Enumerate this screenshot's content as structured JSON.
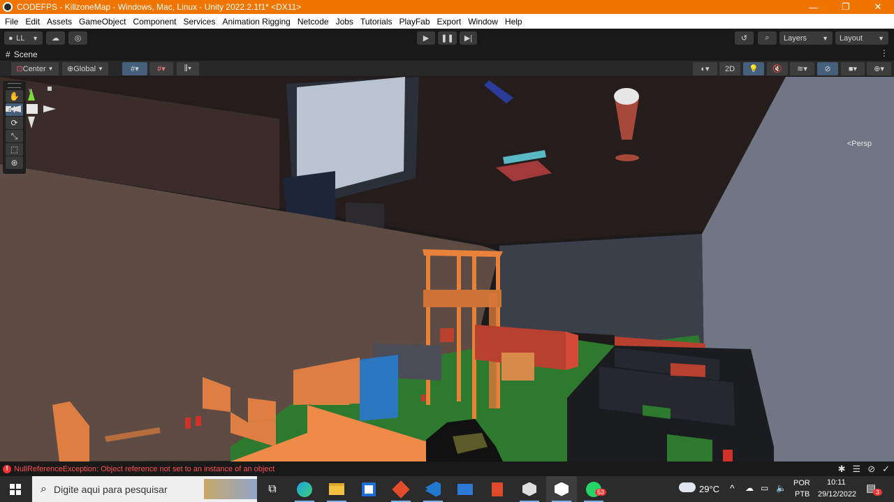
{
  "window": {
    "title": "CODEFPS - KillzoneMap - Windows, Mac, Linux - Unity 2022.2.1f1* <DX11>",
    "minimize": "—",
    "restore": "❐",
    "close": "✕"
  },
  "menu": [
    "File",
    "Edit",
    "Assets",
    "GameObject",
    "Component",
    "Services",
    "Animation Rigging",
    "Netcode",
    "Jobs",
    "Tutorials",
    "PlayFab",
    "Export",
    "Window",
    "Help"
  ],
  "toolbar": {
    "account": "LL",
    "layers": "Layers",
    "layout": "Layout"
  },
  "scene": {
    "tab_label": "Scene",
    "pivot": "Center",
    "space": "Global",
    "mode_2d": "2D",
    "persp": "Persp"
  },
  "status": {
    "error_message": "NullReferenceException: Object reference not set to an instance of an object"
  },
  "taskbar": {
    "search_placeholder": "Digite aqui para pesquisar",
    "weather": "29°C",
    "lang_top": "POR",
    "lang_bottom": "PTB",
    "time": "10:11",
    "date": "29/12/2022",
    "whatsapp_badge": "53",
    "notifications_badge": "3"
  }
}
